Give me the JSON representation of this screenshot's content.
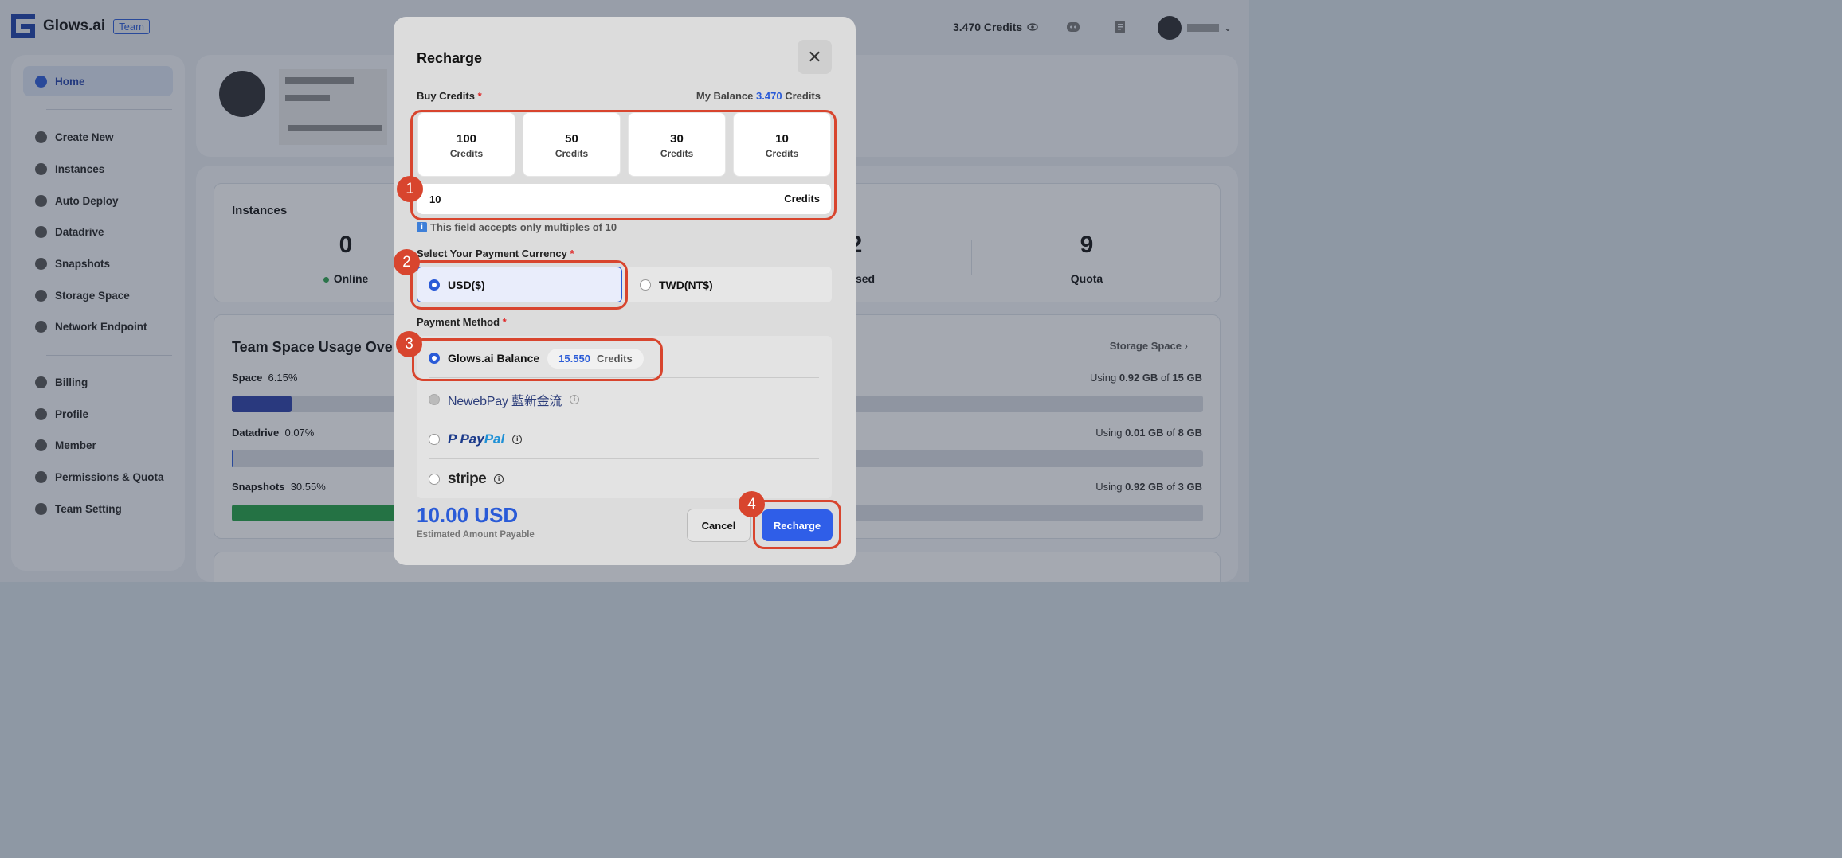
{
  "app": {
    "name": "Glows.ai",
    "badge": "Team",
    "credits": "3.470 Credits"
  },
  "sidebar": {
    "items": [
      {
        "label": "Home"
      },
      {
        "label": "Create New"
      },
      {
        "label": "Instances"
      },
      {
        "label": "Auto Deploy"
      },
      {
        "label": "Datadrive"
      },
      {
        "label": "Snapshots"
      },
      {
        "label": "Storage Space"
      },
      {
        "label": "Network Endpoint"
      },
      {
        "label": "Billing"
      },
      {
        "label": "Profile"
      },
      {
        "label": "Member"
      },
      {
        "label": "Permissions & Quota"
      },
      {
        "label": "Team Setting"
      }
    ]
  },
  "instances": {
    "title": "Instances",
    "online_value": "0",
    "online_label": "Online",
    "used_value": "2",
    "used_label": "sed",
    "quota_value": "9",
    "quota_label": "Quota"
  },
  "usage": {
    "title": "Team Space Usage Over",
    "storage_link": "Storage Space",
    "rows": [
      {
        "label": "Space",
        "pct": "6.15%",
        "pre": "Using",
        "used": "0.92 GB",
        "of": "of",
        "total": "15 GB",
        "fill": 0.0615
      },
      {
        "label": "Datadrive",
        "pct": "0.07%",
        "pre": "Using",
        "used": "0.01 GB",
        "of": "of",
        "total": "8 GB",
        "fill": 0.0007
      },
      {
        "label": "Snapshots",
        "pct": "30.55%",
        "pre": "Using",
        "used": "0.92 GB",
        "of": "of",
        "total": "3 GB",
        "fill": 0.3055
      }
    ]
  },
  "modal": {
    "title": "Recharge",
    "buy_label": "Buy Credits",
    "required": "*",
    "balance_label": "My Balance",
    "balance_value": "3.470",
    "balance_unit": "Credits",
    "options": [
      {
        "value": "100",
        "unit": "Credits"
      },
      {
        "value": "50",
        "unit": "Credits"
      },
      {
        "value": "30",
        "unit": "Credits"
      },
      {
        "value": "10",
        "unit": "Credits"
      }
    ],
    "input_value": "10",
    "input_unit": "Credits",
    "hint": "This field accepts only multiples of 10",
    "currency_label": "Select Your Payment Currency",
    "currency_options": [
      "USD($)",
      "TWD(NT$)"
    ],
    "payment_label": "Payment Method",
    "glows_balance_label": "Glows.ai Balance",
    "glows_balance_value": "15.550",
    "glows_balance_unit": "Credits",
    "newebpay": "NewebPay 藍新金流",
    "paypal_a": "Pay",
    "paypal_b": "Pal",
    "stripe": "stripe",
    "amount": "10.00 USD",
    "amount_label": "Estimated Amount Payable",
    "cancel": "Cancel",
    "recharge": "Recharge"
  },
  "steps": [
    "1",
    "2",
    "3",
    "4"
  ],
  "colors": {
    "accent": "#2a5bd7",
    "highlight": "#d8452e"
  }
}
